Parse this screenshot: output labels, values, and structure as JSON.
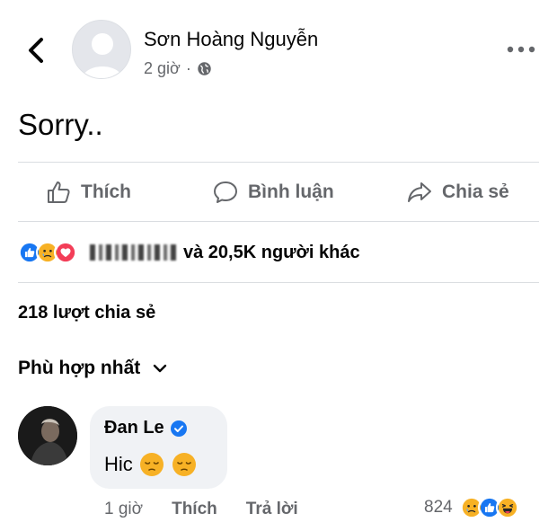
{
  "post": {
    "author": "Sơn Hoàng Nguyễn",
    "time": "2 giờ",
    "separator": "·",
    "text": "Sorry.."
  },
  "actions": {
    "like": "Thích",
    "comment": "Bình luận",
    "share": "Chia sẻ"
  },
  "reactions": {
    "icons": [
      "like-icon",
      "sad-icon",
      "love-icon"
    ],
    "summary": "và 20,5K người khác"
  },
  "shares": "218 lượt chia sẻ",
  "sort": {
    "label": "Phù hợp nhất"
  },
  "comment": {
    "author": "Đan Le",
    "text": "Hic",
    "emojis": [
      "pensive-emoji",
      "pensive-emoji"
    ],
    "time": "1 giờ",
    "like": "Thích",
    "reply": "Trả lời",
    "reaction_count": "824",
    "reaction_icons": [
      "sad-icon",
      "like-icon",
      "haha-icon"
    ]
  },
  "colors": {
    "accent": "#1877f2",
    "love": "#f33e58",
    "emoji": "#f7b125",
    "secondary_text": "#65676b"
  }
}
